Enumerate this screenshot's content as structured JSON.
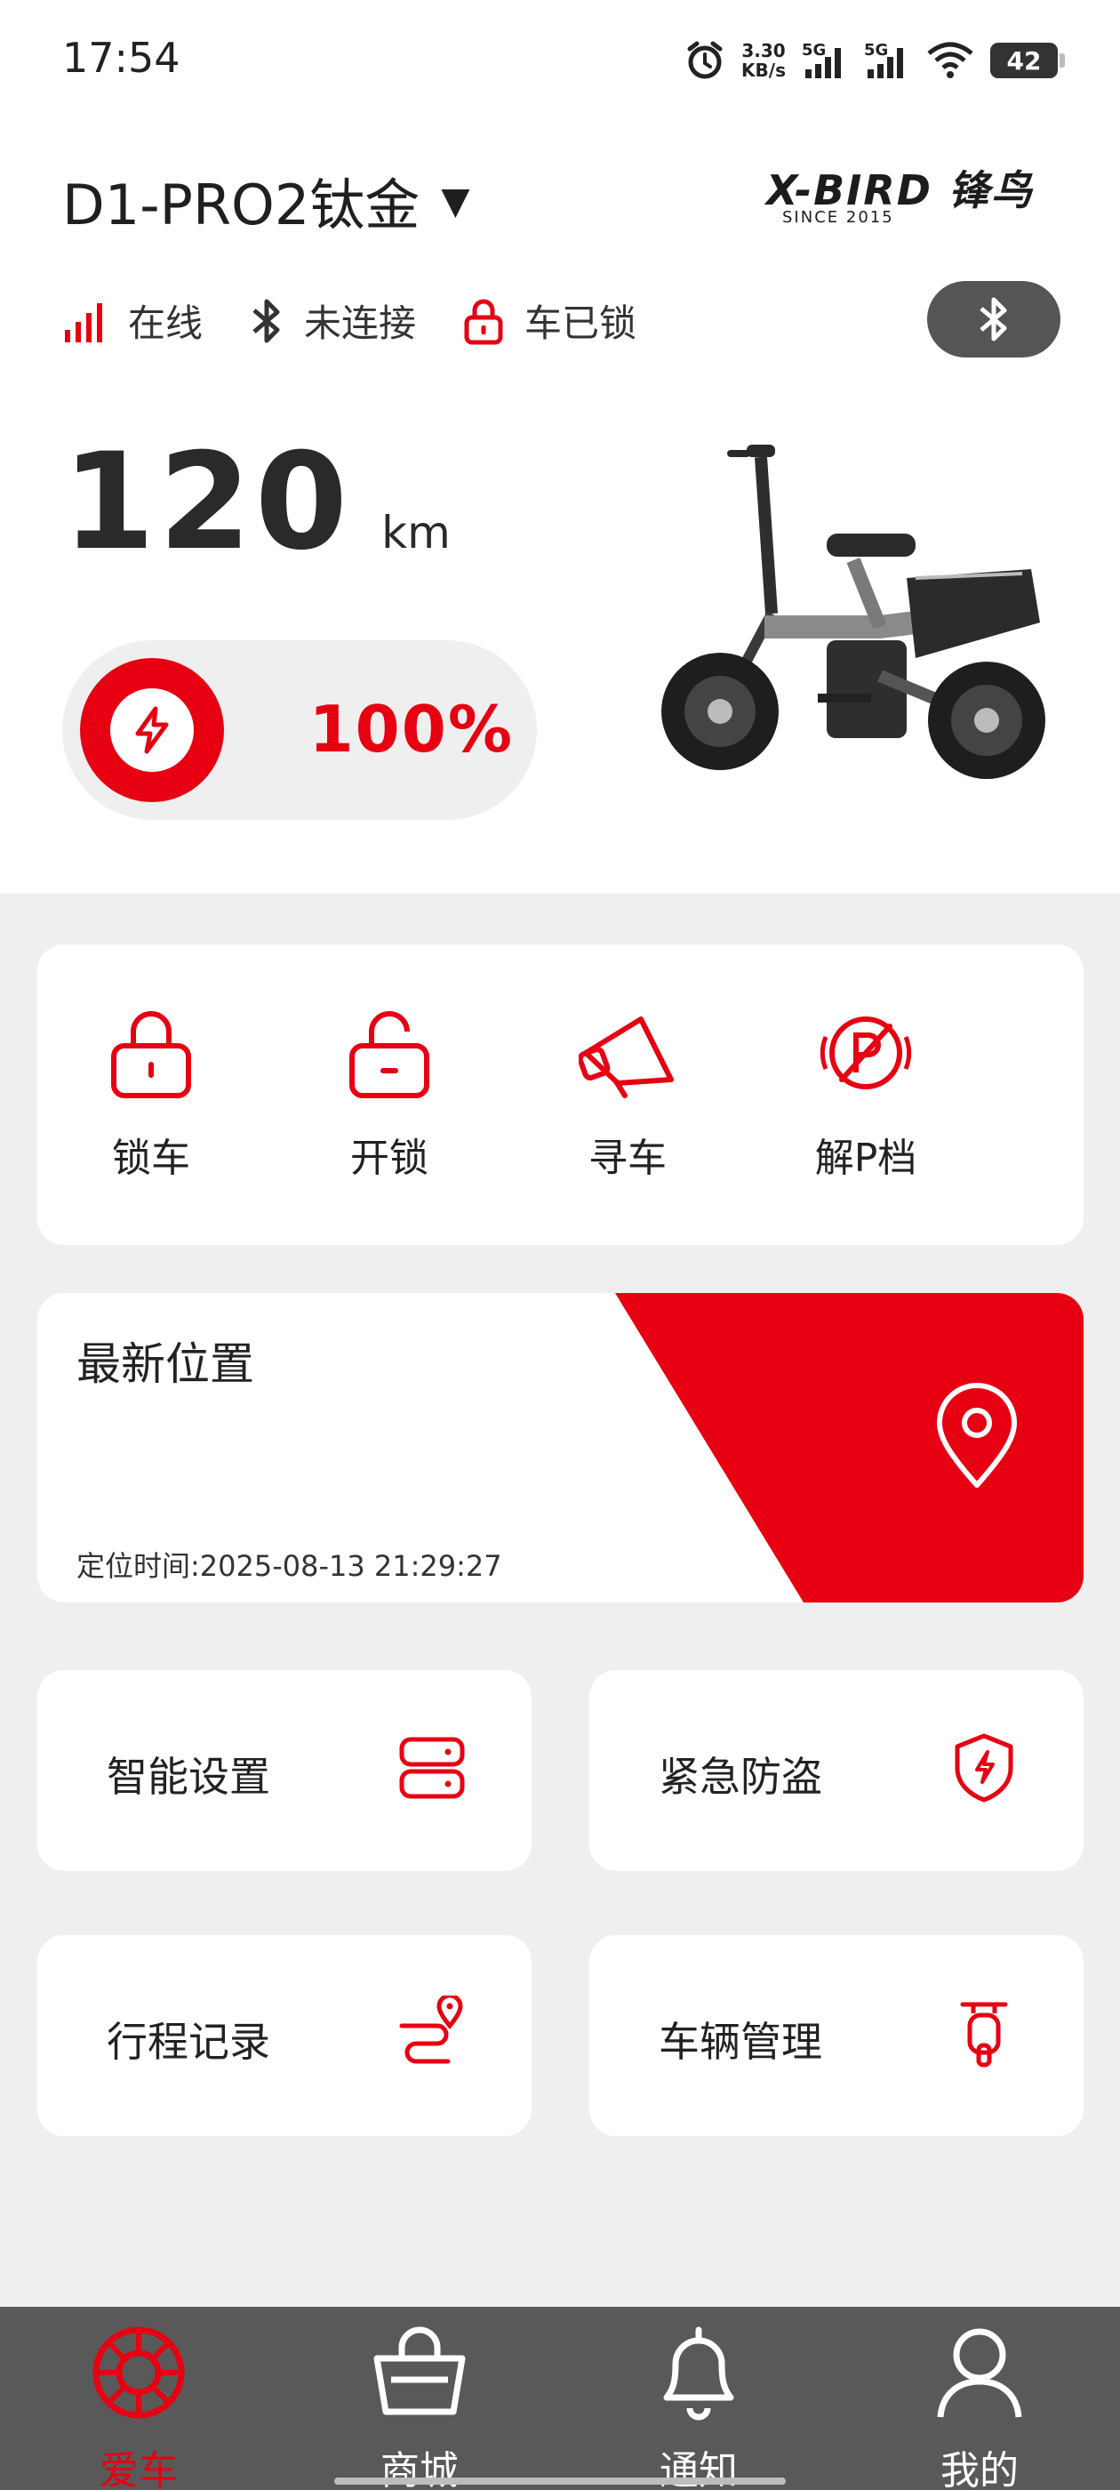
{
  "status_bar": {
    "time": "17:54",
    "net_speed": "3.30",
    "net_speed_unit": "KB/s",
    "sim1": "5G",
    "sim2": "5G",
    "battery": "42"
  },
  "header": {
    "vehicle_name": "D1-PRO2钛金",
    "dropdown_caret": "▼",
    "brand": "X-BIRD 锋鸟",
    "brand_since": "SINCE 2015"
  },
  "connection": {
    "network": "在线",
    "bluetooth": "未连接",
    "lock": "车已锁"
  },
  "range": {
    "value": "120",
    "unit": "km"
  },
  "battery_level": {
    "text": "100%",
    "fraction": 1.0
  },
  "actions": [
    {
      "label": "锁车",
      "icon": "lock-icon"
    },
    {
      "label": "开锁",
      "icon": "unlock-icon"
    },
    {
      "label": "寻车",
      "icon": "megaphone-icon"
    },
    {
      "label": "解P档",
      "icon": "no-parking-icon"
    }
  ],
  "location": {
    "title": "最新位置",
    "time": "定位时间:2025-08-13 21:29:27"
  },
  "tiles": [
    {
      "label": "智能设置",
      "icon": "settings-stack-icon"
    },
    {
      "label": "紧急防盗",
      "icon": "shield-bolt-icon"
    },
    {
      "label": "行程记录",
      "icon": "route-icon"
    },
    {
      "label": "车辆管理",
      "icon": "scooter-icon"
    }
  ],
  "nav": [
    {
      "label": "爱车",
      "icon": "wheel-icon",
      "active": true
    },
    {
      "label": "商城",
      "icon": "basket-icon",
      "active": false
    },
    {
      "label": "通知",
      "icon": "bell-icon",
      "active": false
    },
    {
      "label": "我的",
      "icon": "user-icon",
      "active": false
    }
  ],
  "colors": {
    "accent": "#e60012",
    "nav_bg": "#595959",
    "page_bg": "#efefef"
  }
}
